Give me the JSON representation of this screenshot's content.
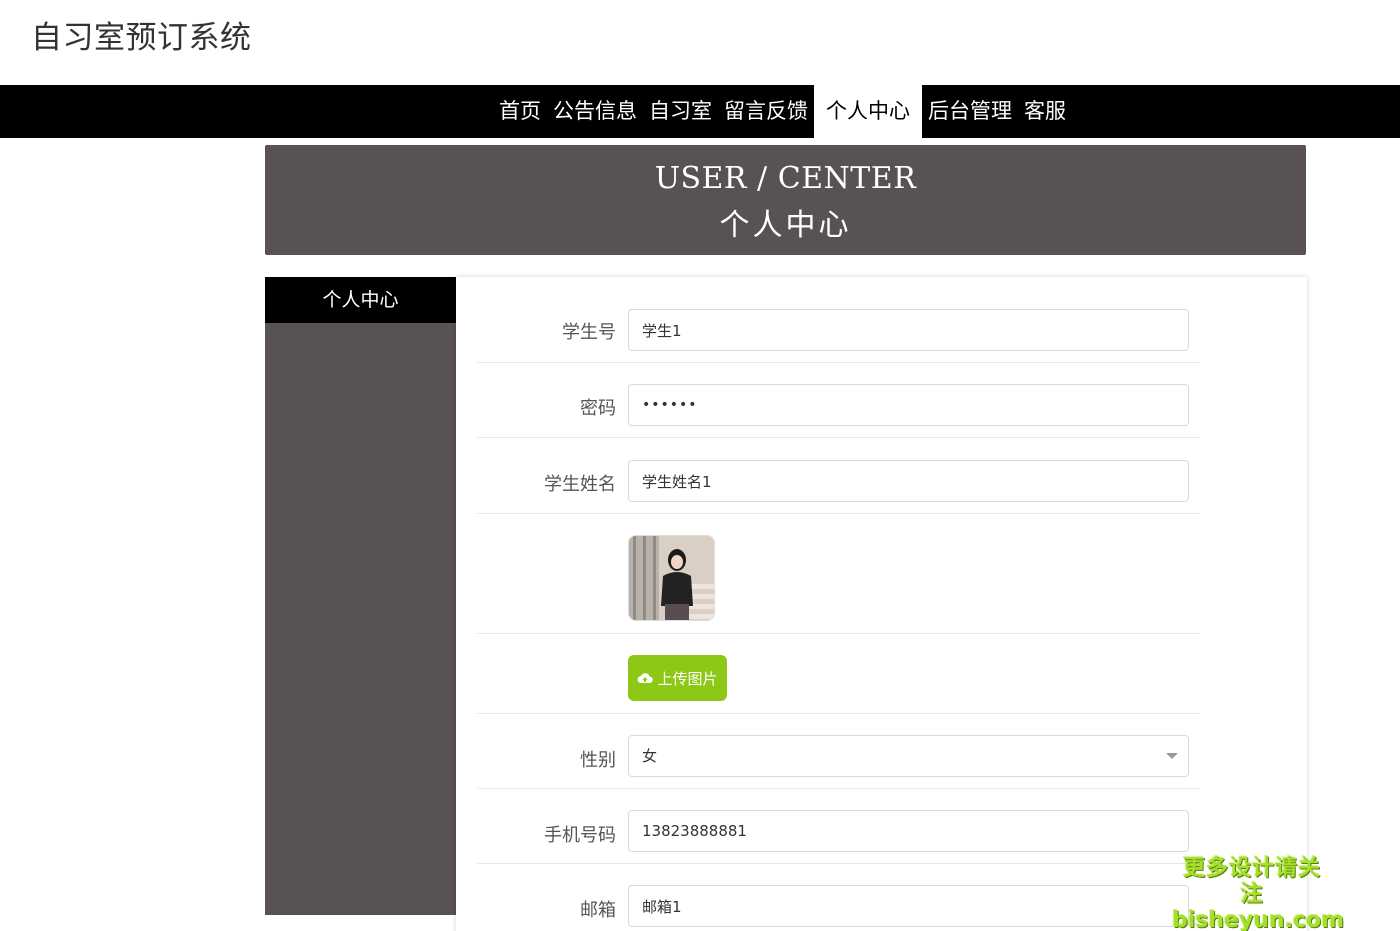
{
  "site": {
    "title": "自习室预订系统"
  },
  "nav": {
    "items": [
      {
        "label": "首页",
        "active": false
      },
      {
        "label": "公告信息",
        "active": false
      },
      {
        "label": "自习室",
        "active": false
      },
      {
        "label": "留言反馈",
        "active": false
      },
      {
        "label": "个人中心",
        "active": true
      },
      {
        "label": "后台管理",
        "active": false
      },
      {
        "label": "客服",
        "active": false
      }
    ]
  },
  "banner": {
    "title_en": "USER / CENTER",
    "title_cn": "个人中心"
  },
  "sidebar": {
    "items": [
      {
        "label": "个人中心",
        "active": true
      }
    ]
  },
  "form": {
    "student_id": {
      "label": "学生号",
      "value": "学生1"
    },
    "password": {
      "label": "密码",
      "value": "••••••"
    },
    "student_name": {
      "label": "学生姓名",
      "value": "学生姓名1"
    },
    "avatar": {
      "icon": "student-photo"
    },
    "upload": {
      "label": "上传图片",
      "icon": "cloud-upload-icon"
    },
    "gender": {
      "label": "性别",
      "value": "女"
    },
    "phone": {
      "label": "手机号码",
      "value": "13823888881"
    },
    "email": {
      "label": "邮箱",
      "value": "邮箱1"
    }
  },
  "watermark": {
    "line1": "更多设计请关注",
    "line2": "bisheyun.com"
  },
  "colors": {
    "nav_bg": "#000000",
    "banner_bg": "#585252",
    "sidebar_bg": "#585252",
    "upload_btn": "#8cc815"
  }
}
